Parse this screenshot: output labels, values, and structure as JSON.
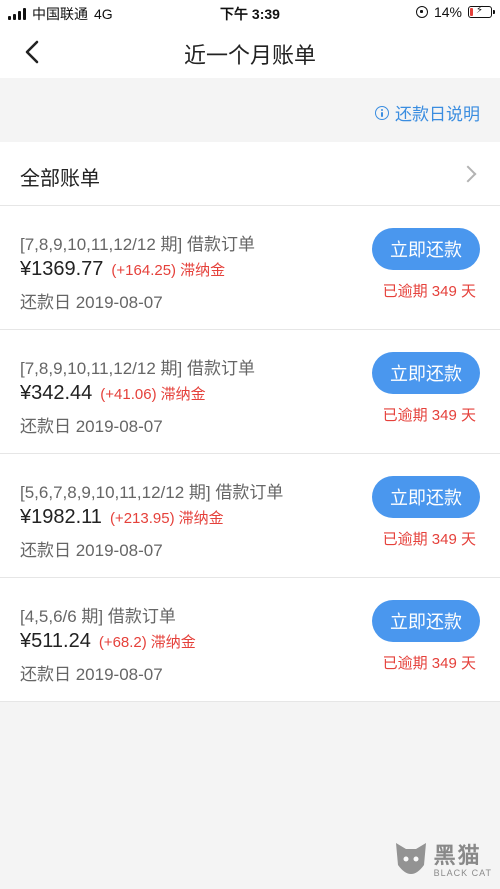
{
  "status_bar": {
    "carrier": "中国联通",
    "network": "4G",
    "time": "下午 3:39",
    "battery": "14%",
    "battery_level": 0.14
  },
  "nav": {
    "title": "近一个月账单",
    "back_icon": "chevron-left-icon"
  },
  "help": {
    "label": "还款日说明",
    "icon": "info-icon"
  },
  "all_bills": {
    "label": "全部账单"
  },
  "bills": [
    {
      "title": "[7,8,9,10,11,12/12 期] 借款订单",
      "amount": "¥1369.77",
      "late_fee": "(+164.25)",
      "late_fee_label": "滞纳金",
      "due_date": "还款日 2019-08-07",
      "button": "立即还款",
      "overdue": "已逾期 349 天"
    },
    {
      "title": "[7,8,9,10,11,12/12 期] 借款订单",
      "amount": "¥342.44",
      "late_fee": "(+41.06)",
      "late_fee_label": "滞纳金",
      "due_date": "还款日 2019-08-07",
      "button": "立即还款",
      "overdue": "已逾期 349 天"
    },
    {
      "title": "[5,6,7,8,9,10,11,12/12 期] 借款订单",
      "amount": "¥1982.11",
      "late_fee": "(+213.95)",
      "late_fee_label": "滞纳金",
      "due_date": "还款日 2019-08-07",
      "button": "立即还款",
      "overdue": "已逾期 349 天"
    },
    {
      "title": "[4,5,6/6 期] 借款订单",
      "amount": "¥511.24",
      "late_fee": "(+68.2)",
      "late_fee_label": "滞纳金",
      "due_date": "还款日 2019-08-07",
      "button": "立即还款",
      "overdue": "已逾期 349 天"
    }
  ],
  "watermark": {
    "cn": "黑猫",
    "en": "BLACK CAT"
  },
  "colors": {
    "accent": "#4a97ee",
    "link": "#3a8de0",
    "danger": "#e5413b",
    "background": "#f4f4f4"
  }
}
